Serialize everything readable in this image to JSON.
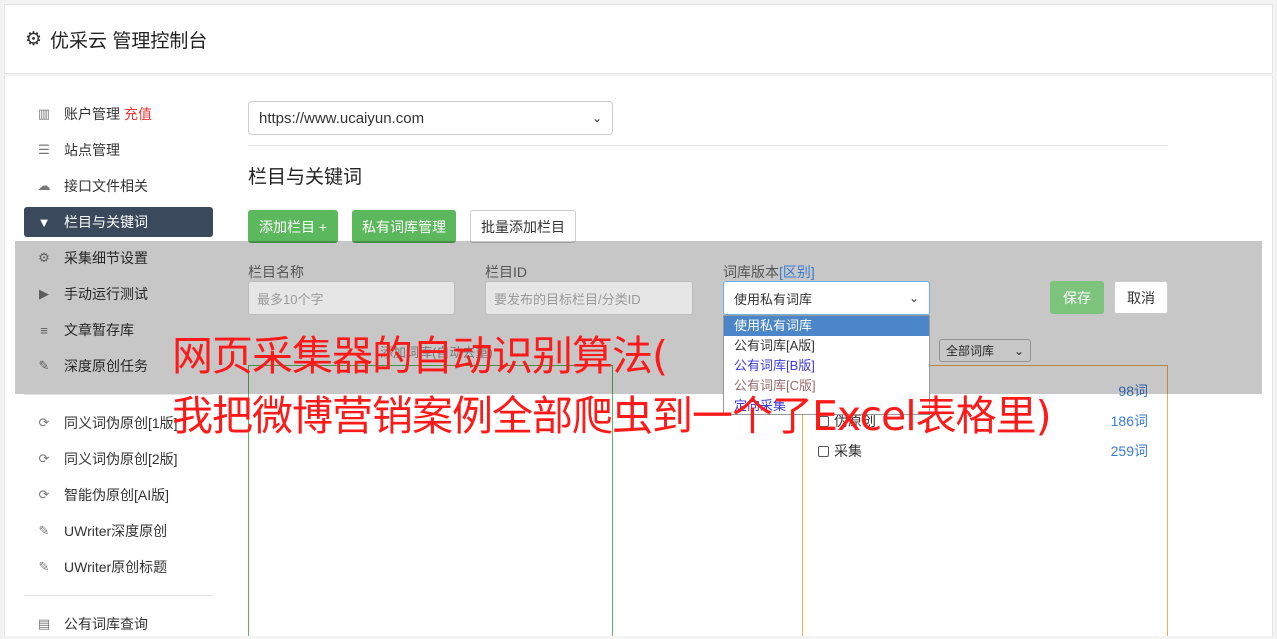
{
  "header": {
    "title": "优采云 管理控制台"
  },
  "sidebar": {
    "items": [
      {
        "label": "账户管理",
        "badge": "充值"
      },
      {
        "label": "站点管理"
      },
      {
        "label": "接口文件相关"
      },
      {
        "label": "栏目与关键词"
      },
      {
        "label": "采集细节设置"
      },
      {
        "label": "手动运行测试"
      },
      {
        "label": "文章暂存库"
      },
      {
        "label": "深度原创任务"
      },
      {
        "label": "同义词伪原创[1版]"
      },
      {
        "label": "同义词伪原创[2版]"
      },
      {
        "label": "智能伪原创[AI版]"
      },
      {
        "label": "UWriter深度原创"
      },
      {
        "label": "UWriter原创标题"
      },
      {
        "label": "公有词库查询"
      }
    ]
  },
  "main": {
    "site_select": "https://www.ucaiyun.com",
    "section_title": "栏目与关键词",
    "buttons": {
      "add_column": "添加栏目 +",
      "private_lib": "私有词库管理",
      "batch_add": "批量添加栏目"
    },
    "form": {
      "name_label": "栏目名称",
      "name_placeholder": "最多10个字",
      "id_label": "栏目ID",
      "id_placeholder": "要发布的目标栏目/分类ID",
      "version_label": "词库版本",
      "version_link": "[区别]",
      "version_value": "使用私有词库",
      "version_options": [
        "使用私有词库",
        "公有词库[A版]",
        "公有词库[B版]",
        "公有词库[C版]",
        "定向采集"
      ],
      "save": "保存",
      "cancel": "取消"
    },
    "keywords_hint": "添加词库(自动去重)",
    "lib_filter": "全部词库",
    "word_groups": [
      {
        "label": "",
        "count": "98词"
      },
      {
        "label": "伪原创",
        "count": "186词"
      },
      {
        "label": "采集",
        "count": "259词"
      }
    ]
  },
  "watermark": {
    "line1": "网页采集器的自动识别算法(",
    "line2": "我把微博营销案例全部爬虫到一个了Excel表格里)"
  },
  "colors": {
    "active_nav": "#3a4a5c",
    "green": "#5cb85c",
    "orange_border": "#f0ad4e",
    "red_text": "#ff1a1a"
  }
}
